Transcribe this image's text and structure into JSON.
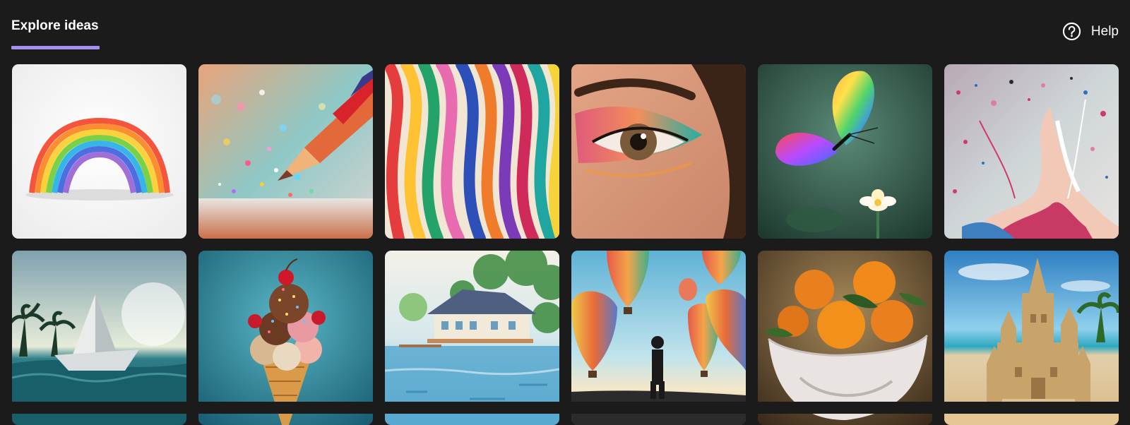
{
  "header": {
    "tab_label": "Explore ideas",
    "help_label": "Help",
    "accent_color": "#a98df0"
  },
  "ideas": [
    {
      "subject": "paper rainbow"
    },
    {
      "subject": "pencil with glitter"
    },
    {
      "subject": "colorful paper ribbons"
    },
    {
      "subject": "eye with colorful makeup"
    },
    {
      "subject": "rainbow butterfly"
    },
    {
      "subject": "paint splash"
    },
    {
      "subject": "paper boat on sea"
    },
    {
      "subject": "ice cream cone with cherries"
    },
    {
      "subject": "watercolor lake house"
    },
    {
      "subject": "hot air balloons"
    },
    {
      "subject": "oranges in a bowl"
    },
    {
      "subject": "sand castle on beach"
    }
  ]
}
